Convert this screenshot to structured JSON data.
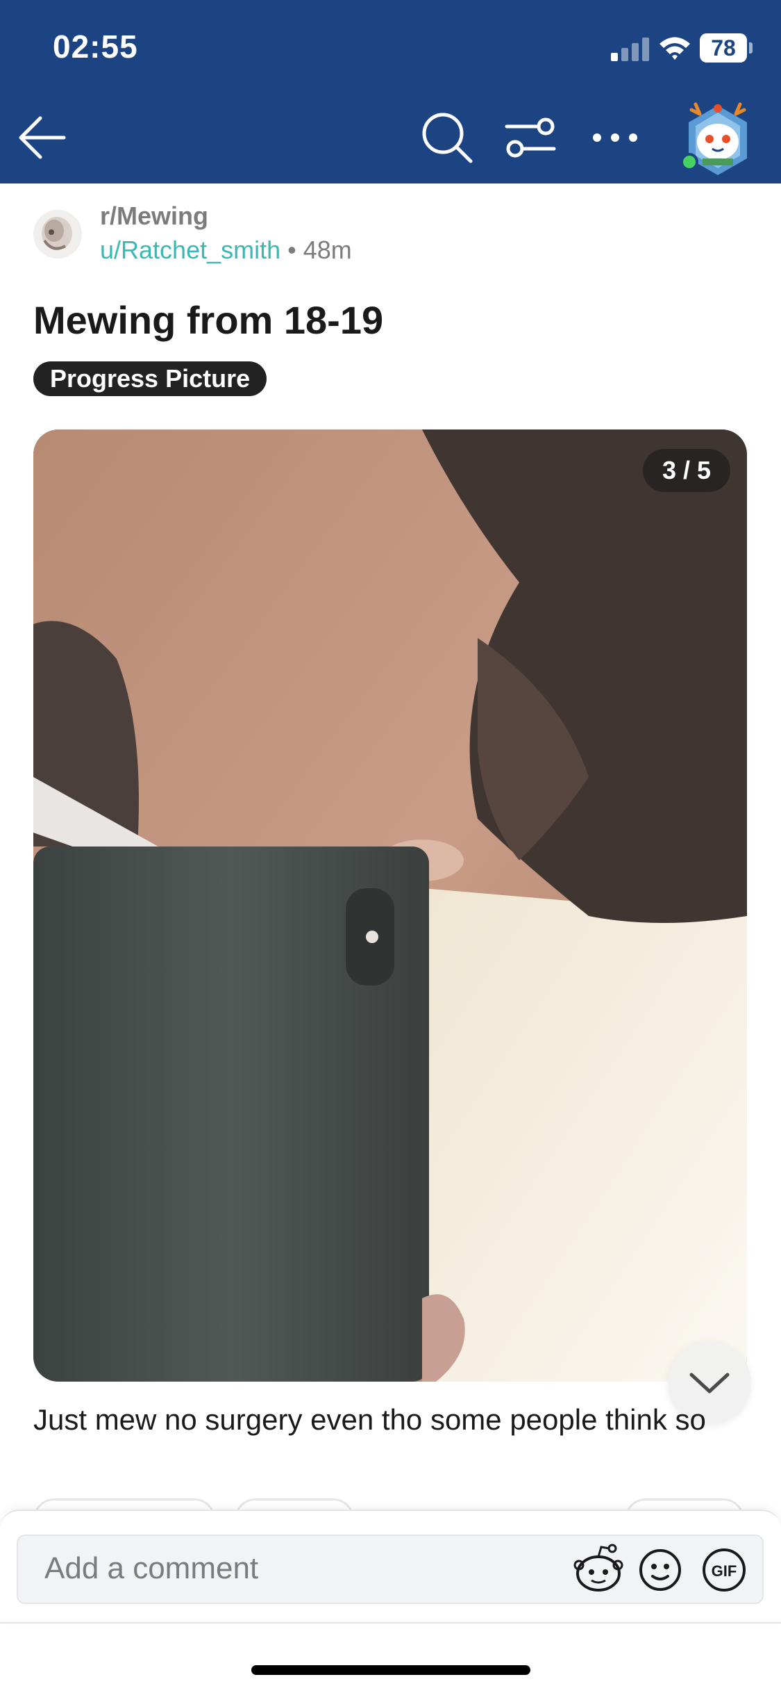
{
  "status_bar": {
    "time": "02:55",
    "battery": "78"
  },
  "nav": {
    "back_icon": "arrow-left-icon",
    "search_icon": "search-icon",
    "filter_icon": "sort-filter-icon",
    "more_icon": "more-horizontal-icon",
    "profile_icon": "user-avatar-icon",
    "online_status_color": "#46d160"
  },
  "post": {
    "subreddit": "r/Mewing",
    "author": "u/Ratchet_smith",
    "separator": "•",
    "age": "48m",
    "title": "Mewing from 18-19",
    "flair": "Progress Picture",
    "gallery_counter": "3 / 5",
    "body": "Just mew no surgery even tho some people think so"
  },
  "comment_bar": {
    "placeholder": "Add a comment",
    "snoo_icon": "snoo-avatar-icon",
    "emoji_icon": "emoji-icon",
    "gif_label": "GIF"
  },
  "colors": {
    "header": "#1c4482",
    "author": "#3bb8b3",
    "flair_bg": "#222222"
  }
}
